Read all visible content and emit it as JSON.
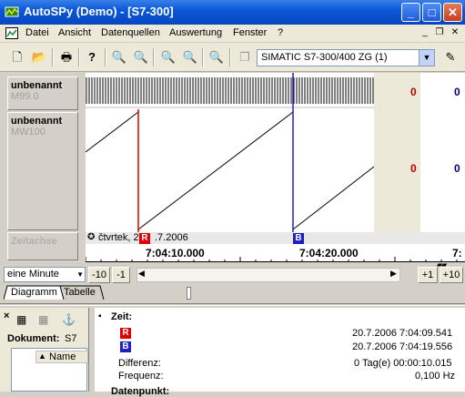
{
  "window": {
    "title": "AutoSPy (Demo) - [S7-300]",
    "app_icon": "autospy-icon",
    "controls": [
      "minimize-icon",
      "maximize-icon",
      "close-icon"
    ]
  },
  "menu": {
    "items": [
      "Datei",
      "Ansicht",
      "Datenquellen",
      "Auswertung",
      "Fenster",
      "?"
    ]
  },
  "toolbar": {
    "plc_select": "SIMATIC S7-300/400 ZG (1)"
  },
  "signals": [
    {
      "name": "unbenannt",
      "address": "M99.0",
      "value1": "0",
      "value2": "0"
    },
    {
      "name": "unbenannt",
      "address": "MW100",
      "value1": "0",
      "value2": "0"
    }
  ],
  "time_axis_label": "Zeitachse",
  "date_text": "čtvrtek, 2",
  "date_text_tail": ".7.2006",
  "cursors": {
    "r": "R",
    "b": "B"
  },
  "ticks": [
    "7:04:10.000",
    "7:04:20.000",
    "7:"
  ],
  "nav": {
    "zoom": "eine Minute",
    "m10": "-10",
    "m1": "-1",
    "p1": "+1",
    "p10": "+10"
  },
  "tabs": [
    "Diagramm",
    "Tabelle"
  ],
  "left_panel": {
    "document_label": "Dokument:",
    "document_value": "S7",
    "name_col": "Name"
  },
  "info": {
    "heading": "Zeit:",
    "r_time": "20.7.2006  7:04:09.541",
    "b_time": "20.7.2006  7:04:19.556",
    "diff_label": "Differenz:",
    "diff_value": "0 Tag(e)  00:00:10.015",
    "freq_label": "Frequenz:",
    "freq_value": "0,100 Hz",
    "next_heading": "Datenpunkt:"
  },
  "colors": {
    "cursor_r": "#e00000",
    "cursor_b": "#2020c0",
    "value": "#c00000",
    "value_blue": "#000080"
  }
}
